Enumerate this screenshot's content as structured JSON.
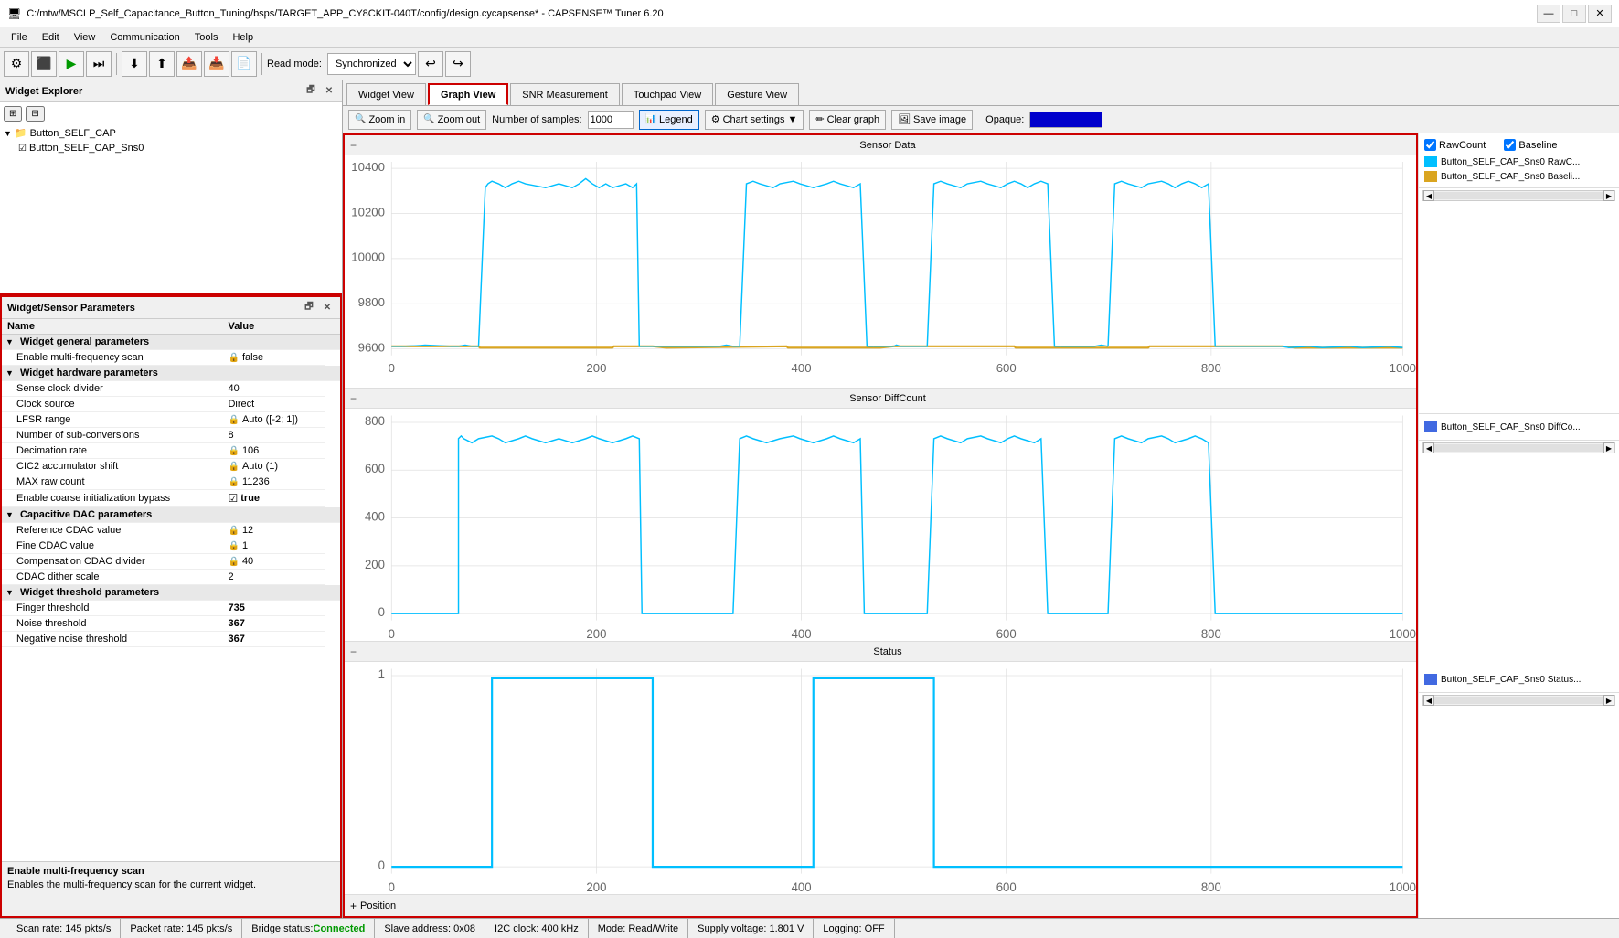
{
  "titlebar": {
    "text": "C:/mtw/MSCLP_Self_Capacitance_Button_Tuning/bsps/TARGET_APP_CY8CKIT-040T/config/design.cycapsense* - CAPSENSE™ Tuner 6.20",
    "minimize": "—",
    "maximize": "□",
    "close": "✕"
  },
  "menu": {
    "items": [
      "File",
      "Edit",
      "View",
      "Communication",
      "Tools",
      "Help"
    ]
  },
  "toolbar": {
    "read_mode_label": "Read mode:",
    "read_mode_value": "Synchronized"
  },
  "widget_explorer": {
    "title": "Widget Explorer",
    "items": [
      {
        "label": "Button_SELF_CAP",
        "level": 0,
        "expanded": true
      },
      {
        "label": "Button_SELF_CAP_Sns0",
        "level": 1
      }
    ]
  },
  "params_panel": {
    "title": "Widget/Sensor Parameters",
    "columns": [
      "Name",
      "Value"
    ],
    "sections": [
      {
        "label": "Widget general parameters",
        "type": "section"
      },
      {
        "name": "Enable multi-frequency scan",
        "value": "false",
        "type": "lock",
        "level": 1
      },
      {
        "label": "Widget hardware parameters",
        "type": "section"
      },
      {
        "name": "Sense clock divider",
        "value": "40",
        "type": "normal",
        "level": 1
      },
      {
        "name": "Clock source",
        "value": "Direct",
        "type": "normal",
        "level": 1
      },
      {
        "name": "LFSR range",
        "value": "Auto ([-2; 1])",
        "type": "lock",
        "level": 1
      },
      {
        "name": "Number of sub-conversions",
        "value": "8",
        "type": "normal",
        "level": 1
      },
      {
        "name": "Decimation rate",
        "value": "106",
        "type": "lock",
        "level": 1
      },
      {
        "name": "CIC2 accumulator shift",
        "value": "Auto (1)",
        "type": "lock",
        "level": 1
      },
      {
        "name": "MAX raw count",
        "value": "11236",
        "type": "lock",
        "level": 1
      },
      {
        "name": "Enable coarse initialization bypass",
        "value": "true",
        "type": "checkbox",
        "level": 1
      },
      {
        "label": "Capacitive DAC parameters",
        "type": "section"
      },
      {
        "name": "Reference CDAC value",
        "value": "12",
        "type": "lock",
        "level": 1
      },
      {
        "name": "Fine CDAC value",
        "value": "1",
        "type": "lock",
        "level": 1
      },
      {
        "name": "Compensation CDAC divider",
        "value": "40",
        "type": "lock",
        "level": 1
      },
      {
        "name": "CDAC dither scale",
        "value": "2",
        "type": "normal",
        "level": 1
      },
      {
        "label": "Widget threshold parameters",
        "type": "section"
      },
      {
        "name": "Finger threshold",
        "value": "735",
        "type": "bold",
        "level": 1
      },
      {
        "name": "Noise threshold",
        "value": "367",
        "type": "bold",
        "level": 1
      },
      {
        "name": "Negative noise threshold",
        "value": "367",
        "type": "bold",
        "level": 1
      }
    ],
    "status_title": "Enable multi-frequency scan",
    "status_desc": "Enables the multi-frequency scan for the current widget."
  },
  "tabs": {
    "items": [
      "Widget View",
      "Graph View",
      "SNR Measurement",
      "Touchpad View",
      "Gesture View"
    ],
    "active": "Graph View"
  },
  "graph_toolbar": {
    "zoom_in": "🔍 Zoom in",
    "zoom_out": "🔍 Zoom out",
    "num_samples_label": "Number of samples:",
    "num_samples_value": "1000",
    "legend": "Legend",
    "chart_settings": "Chart settings",
    "clear_graph": "Clear graph",
    "save_image": "Save image",
    "opaque_label": "Opaque:"
  },
  "graphs": [
    {
      "id": "sensor-data",
      "title": "Sensor Data",
      "y_min": 9600,
      "y_max": 10400,
      "y_labels": [
        "10400",
        "10200",
        "10000",
        "9800",
        "9600"
      ],
      "x_labels": [
        "0",
        "200",
        "400",
        "600",
        "800",
        "1000"
      ]
    },
    {
      "id": "diff-count",
      "title": "Sensor DiffCount",
      "y_min": 0,
      "y_max": 800,
      "y_labels": [
        "800",
        "600",
        "400",
        "200",
        "0"
      ],
      "x_labels": [
        "0",
        "200",
        "400",
        "600",
        "800",
        "1000"
      ]
    },
    {
      "id": "status",
      "title": "Status",
      "y_min": 0,
      "y_max": 1,
      "y_labels": [
        "1",
        "0"
      ],
      "x_labels": [
        "0",
        "200",
        "400",
        "600",
        "800",
        "1000"
      ]
    }
  ],
  "legend": {
    "rawcount_label": "RawCount",
    "baseline_label": "Baseline",
    "items": [
      {
        "label": "Button_SELF_CAP_Sns0 RawC...",
        "color": "#00bfff"
      },
      {
        "label": "Button_SELF_CAP_Sns0 Baseli...",
        "color": "#daa520"
      }
    ],
    "diff_items": [
      {
        "label": "Button_SELF_CAP_Sns0 DiffCo...",
        "color": "#4169e1"
      }
    ],
    "status_items": [
      {
        "label": "Button_SELF_CAP_Sns0 Status...",
        "color": "#4169e1"
      }
    ]
  },
  "position_bar": {
    "label": "Position",
    "expand": "+"
  },
  "status_bar": {
    "scan_rate": "Scan rate:  145 pkts/s",
    "packet_rate": "Packet rate:  145 pkts/s",
    "bridge_status_label": "Bridge status:",
    "bridge_status_value": "Connected",
    "slave_address": "Slave address:  0x08",
    "i2c_clock": "I2C clock:  400 kHz",
    "mode": "Mode:  Read/Write",
    "supply_voltage": "Supply voltage:  1.801 V",
    "logging": "Logging:  OFF"
  }
}
